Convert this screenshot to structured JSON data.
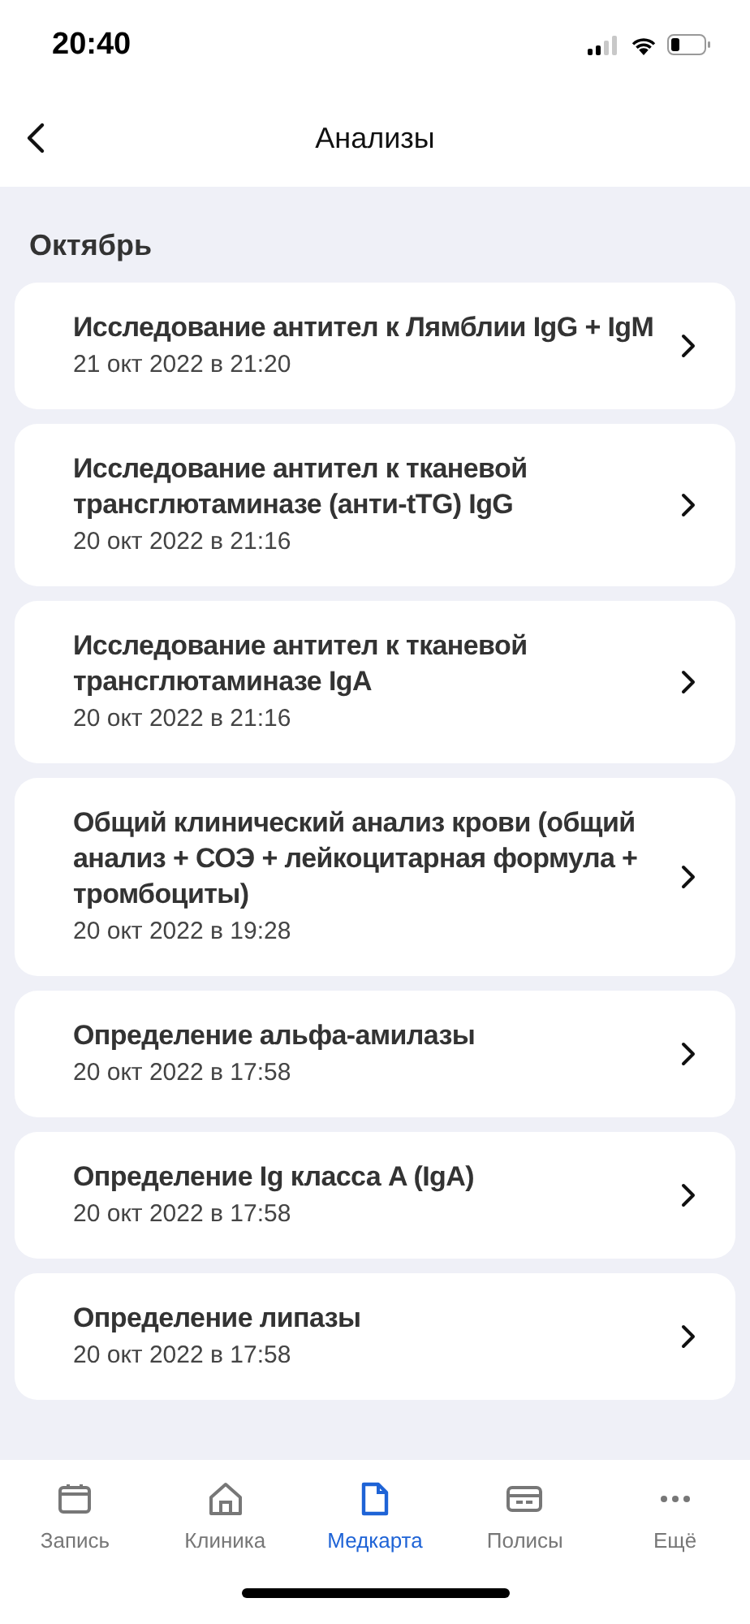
{
  "status_bar": {
    "time": "20:40"
  },
  "header": {
    "title": "Анализы"
  },
  "section": {
    "title": "Октябрь"
  },
  "items": [
    {
      "title": "Исследование антител к Лямблии IgG + IgM",
      "date": "21 окт 2022 в 21:20"
    },
    {
      "title": "Исследование антител к тканевой трансглютаминазе (анти-tTG) IgG",
      "date": "20 окт 2022 в 21:16"
    },
    {
      "title": "Исследование антител к тканевой трансглютаминазе IgA",
      "date": "20 окт 2022 в 21:16"
    },
    {
      "title": "Общий клинический анализ крови (общий анализ + СОЭ + лейкоцитарная формула + тромбоциты)",
      "date": "20 окт 2022 в 19:28"
    },
    {
      "title": "Определение альфа-амилазы",
      "date": "20 окт 2022 в 17:58"
    },
    {
      "title": "Определение Ig класса A (IgA)",
      "date": "20 окт 2022 в 17:58"
    },
    {
      "title": "Определение липазы",
      "date": "20 окт 2022 в 17:58"
    }
  ],
  "tabs": [
    {
      "kind": "calendar",
      "label": "Запись",
      "selected": false
    },
    {
      "kind": "clinic",
      "label": "Клиника",
      "selected": false
    },
    {
      "kind": "document",
      "label": "Медкарта",
      "selected": true
    },
    {
      "kind": "card",
      "label": "Полисы",
      "selected": false
    },
    {
      "kind": "more",
      "label": "Ещё",
      "selected": false
    }
  ]
}
